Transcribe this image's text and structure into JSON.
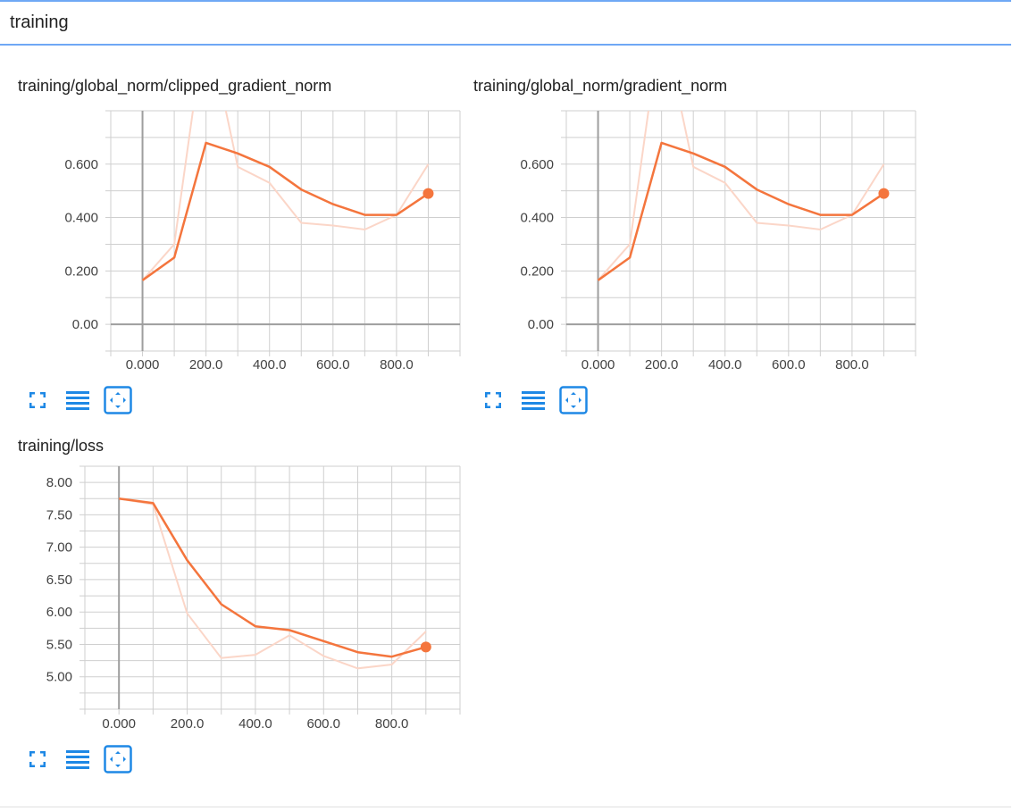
{
  "section": {
    "title": "training"
  },
  "colors": {
    "accent": "#6fa8f5",
    "series": "#f4753d",
    "series_raw": "#fbd6c8",
    "icon": "#1e88e5",
    "grid": "#cfcfcf",
    "axis": "#9e9e9e"
  },
  "icons": {
    "expand": "fullscreen-icon",
    "data": "list-icon",
    "fit": "fit-domain-icon"
  },
  "charts": [
    {
      "title": "training/global_norm/clipped_gradient_norm",
      "chart_data": {
        "type": "line",
        "x_ticks": [
          "0.000",
          "200.0",
          "400.0",
          "600.0",
          "800.0"
        ],
        "y_ticks": [
          "0.00",
          "0.200",
          "0.400",
          "0.600"
        ],
        "xlim": [
          -100,
          1000
        ],
        "ylim": [
          -0.1,
          0.8
        ],
        "grid": true,
        "series": [
          {
            "values": [
              {
                "x": 0,
                "y": 0.165
              },
              {
                "x": 100,
                "y": 0.25
              },
              {
                "x": 200,
                "y": 0.68
              },
              {
                "x": 300,
                "y": 0.64
              },
              {
                "x": 400,
                "y": 0.59
              },
              {
                "x": 500,
                "y": 0.505
              },
              {
                "x": 600,
                "y": 0.45
              },
              {
                "x": 700,
                "y": 0.41
              },
              {
                "x": 800,
                "y": 0.41
              },
              {
                "x": 900,
                "y": 0.49
              }
            ]
          },
          {
            "values": [
              {
                "x": 0,
                "y": 0.165
              },
              {
                "x": 100,
                "y": 0.3
              },
              {
                "x": 200,
                "y": 1.15
              },
              {
                "x": 300,
                "y": 0.59
              },
              {
                "x": 400,
                "y": 0.53
              },
              {
                "x": 500,
                "y": 0.38
              },
              {
                "x": 600,
                "y": 0.37
              },
              {
                "x": 700,
                "y": 0.355
              },
              {
                "x": 800,
                "y": 0.41
              },
              {
                "x": 900,
                "y": 0.6
              }
            ]
          }
        ]
      }
    },
    {
      "title": "training/global_norm/gradient_norm",
      "chart_data": {
        "type": "line",
        "x_ticks": [
          "0.000",
          "200.0",
          "400.0",
          "600.0",
          "800.0"
        ],
        "y_ticks": [
          "0.00",
          "0.200",
          "0.400",
          "0.600"
        ],
        "xlim": [
          -100,
          1000
        ],
        "ylim": [
          -0.1,
          0.8
        ],
        "grid": true,
        "series": [
          {
            "values": [
              {
                "x": 0,
                "y": 0.165
              },
              {
                "x": 100,
                "y": 0.25
              },
              {
                "x": 200,
                "y": 0.68
              },
              {
                "x": 300,
                "y": 0.64
              },
              {
                "x": 400,
                "y": 0.59
              },
              {
                "x": 500,
                "y": 0.505
              },
              {
                "x": 600,
                "y": 0.45
              },
              {
                "x": 700,
                "y": 0.41
              },
              {
                "x": 800,
                "y": 0.41
              },
              {
                "x": 900,
                "y": 0.49
              }
            ]
          },
          {
            "values": [
              {
                "x": 0,
                "y": 0.165
              },
              {
                "x": 100,
                "y": 0.3
              },
              {
                "x": 200,
                "y": 1.15
              },
              {
                "x": 300,
                "y": 0.59
              },
              {
                "x": 400,
                "y": 0.53
              },
              {
                "x": 500,
                "y": 0.38
              },
              {
                "x": 600,
                "y": 0.37
              },
              {
                "x": 700,
                "y": 0.355
              },
              {
                "x": 800,
                "y": 0.41
              },
              {
                "x": 900,
                "y": 0.6
              }
            ]
          }
        ]
      }
    },
    {
      "title": "training/loss",
      "chart_data": {
        "type": "line",
        "x_ticks": [
          "0.000",
          "200.0",
          "400.0",
          "600.0",
          "800.0"
        ],
        "y_ticks": [
          "5.00",
          "5.50",
          "6.00",
          "6.50",
          "7.00",
          "7.50",
          "8.00"
        ],
        "xlim": [
          -100,
          1000
        ],
        "ylim": [
          4.5,
          8.25
        ],
        "grid": true,
        "series": [
          {
            "values": [
              {
                "x": 0,
                "y": 7.75
              },
              {
                "x": 100,
                "y": 7.68
              },
              {
                "x": 200,
                "y": 6.8
              },
              {
                "x": 300,
                "y": 6.12
              },
              {
                "x": 400,
                "y": 5.78
              },
              {
                "x": 500,
                "y": 5.72
              },
              {
                "x": 600,
                "y": 5.55
              },
              {
                "x": 700,
                "y": 5.38
              },
              {
                "x": 800,
                "y": 5.31
              },
              {
                "x": 900,
                "y": 5.46
              }
            ]
          },
          {
            "values": [
              {
                "x": 0,
                "y": 7.75
              },
              {
                "x": 100,
                "y": 7.66
              },
              {
                "x": 200,
                "y": 5.98
              },
              {
                "x": 300,
                "y": 5.29
              },
              {
                "x": 400,
                "y": 5.34
              },
              {
                "x": 500,
                "y": 5.64
              },
              {
                "x": 600,
                "y": 5.32
              },
              {
                "x": 700,
                "y": 5.13
              },
              {
                "x": 800,
                "y": 5.19
              },
              {
                "x": 900,
                "y": 5.7
              }
            ]
          }
        ]
      }
    }
  ]
}
